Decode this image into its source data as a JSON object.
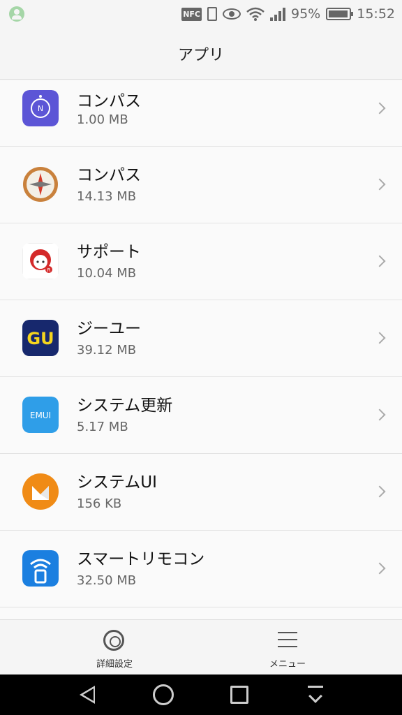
{
  "status_bar": {
    "nfc": "NFC",
    "battery_percent": "95%",
    "battery_level": 0.95,
    "time": "15:52"
  },
  "header": {
    "title": "アプリ"
  },
  "apps": [
    {
      "name": "コンパス",
      "size": "1.00 MB",
      "icon": "compass-purple-icon",
      "color": "#5c55d6"
    },
    {
      "name": "コンパス",
      "size": "14.13 MB",
      "icon": "compass-brown-icon",
      "color": "#c9813c"
    },
    {
      "name": "サポート",
      "size": "10.04 MB",
      "icon": "support-icon",
      "color": "#d42a2a"
    },
    {
      "name": "ジーユー",
      "size": "39.12 MB",
      "icon": "gu-icon",
      "color": "#17286d",
      "icon_text": "GU"
    },
    {
      "name": "システム更新",
      "size": "5.17 MB",
      "icon": "emui-icon",
      "color": "#2f9ee8",
      "icon_text": "EMUI"
    },
    {
      "name": "システムUI",
      "size": "156 KB",
      "icon": "system-ui-icon",
      "color": "#f08b16"
    },
    {
      "name": "スマートリモコン",
      "size": "32.50 MB",
      "icon": "smart-remote-icon",
      "color": "#1b7fe0"
    }
  ],
  "bottom_bar": {
    "settings_label": "詳細設定",
    "menu_label": "メニュー"
  }
}
